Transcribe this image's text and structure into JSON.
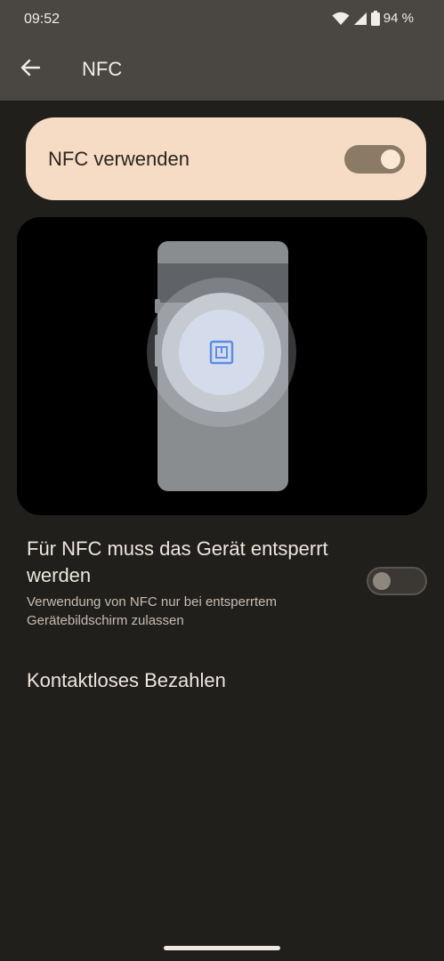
{
  "status": {
    "time": "09:52",
    "battery": "94 %"
  },
  "header": {
    "title": "NFC"
  },
  "main_toggle": {
    "label": "NFC verwenden",
    "on": true
  },
  "lock_setting": {
    "title": "Für NFC muss das Gerät entsperrt werden",
    "subtitle": "Verwendung von NFC nur bei entsperrtem Gerätebildschirm zulassen",
    "on": false
  },
  "payment": {
    "label": "Kontaktloses Bezahlen"
  },
  "colors": {
    "accent": "#f6dcc4",
    "background": "#211f1b",
    "header": "#4a4641",
    "nfc_icon": "#5b8de8"
  }
}
